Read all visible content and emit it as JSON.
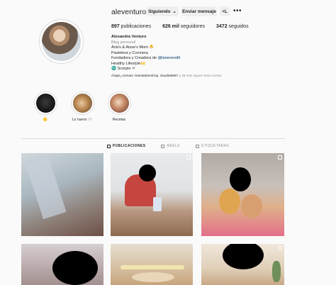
{
  "profile": {
    "username": "aleventuro",
    "buttons": {
      "follow": "Siguiendo",
      "message": "Enviar mensaje",
      "add": "+L"
    },
    "stats": {
      "posts_num": "897",
      "posts_label": "publicaciones",
      "followers_num": "626 mil",
      "followers_label": "seguidores",
      "following_num": "3472",
      "following_label": "seguidos"
    },
    "bio": {
      "name": "Alexandra Venturo",
      "category": "Blog personal",
      "line1": "Aria's & Aisse's Mom 🐣",
      "line2": "Pastelera y Cocinera",
      "line3_prefix": "Fundadora y Creadora de ",
      "line3_mention": "@laneverafit",
      "line4": "Healthy Lifestyle🙌",
      "line5": "♏ Scorpio ♾"
    },
    "followed_by": {
      "names": "chapa_nomad, mamatubershop, claudia9867",
      "suffix": "y 38 más siguen esta cuenta"
    }
  },
  "highlights": [
    {
      "label": "🟡"
    },
    {
      "label": "Lo nuevo 🤍"
    },
    {
      "label": "Recetas"
    }
  ],
  "tabs": [
    {
      "label": "PUBLICACIONES"
    },
    {
      "label": "REELS"
    },
    {
      "label": "ETIQUETADAS"
    }
  ],
  "colors": {
    "background": "#fafafa",
    "button": "#efefef",
    "text": "#262626",
    "muted": "#8e8e8e",
    "mention": "#00376b"
  }
}
